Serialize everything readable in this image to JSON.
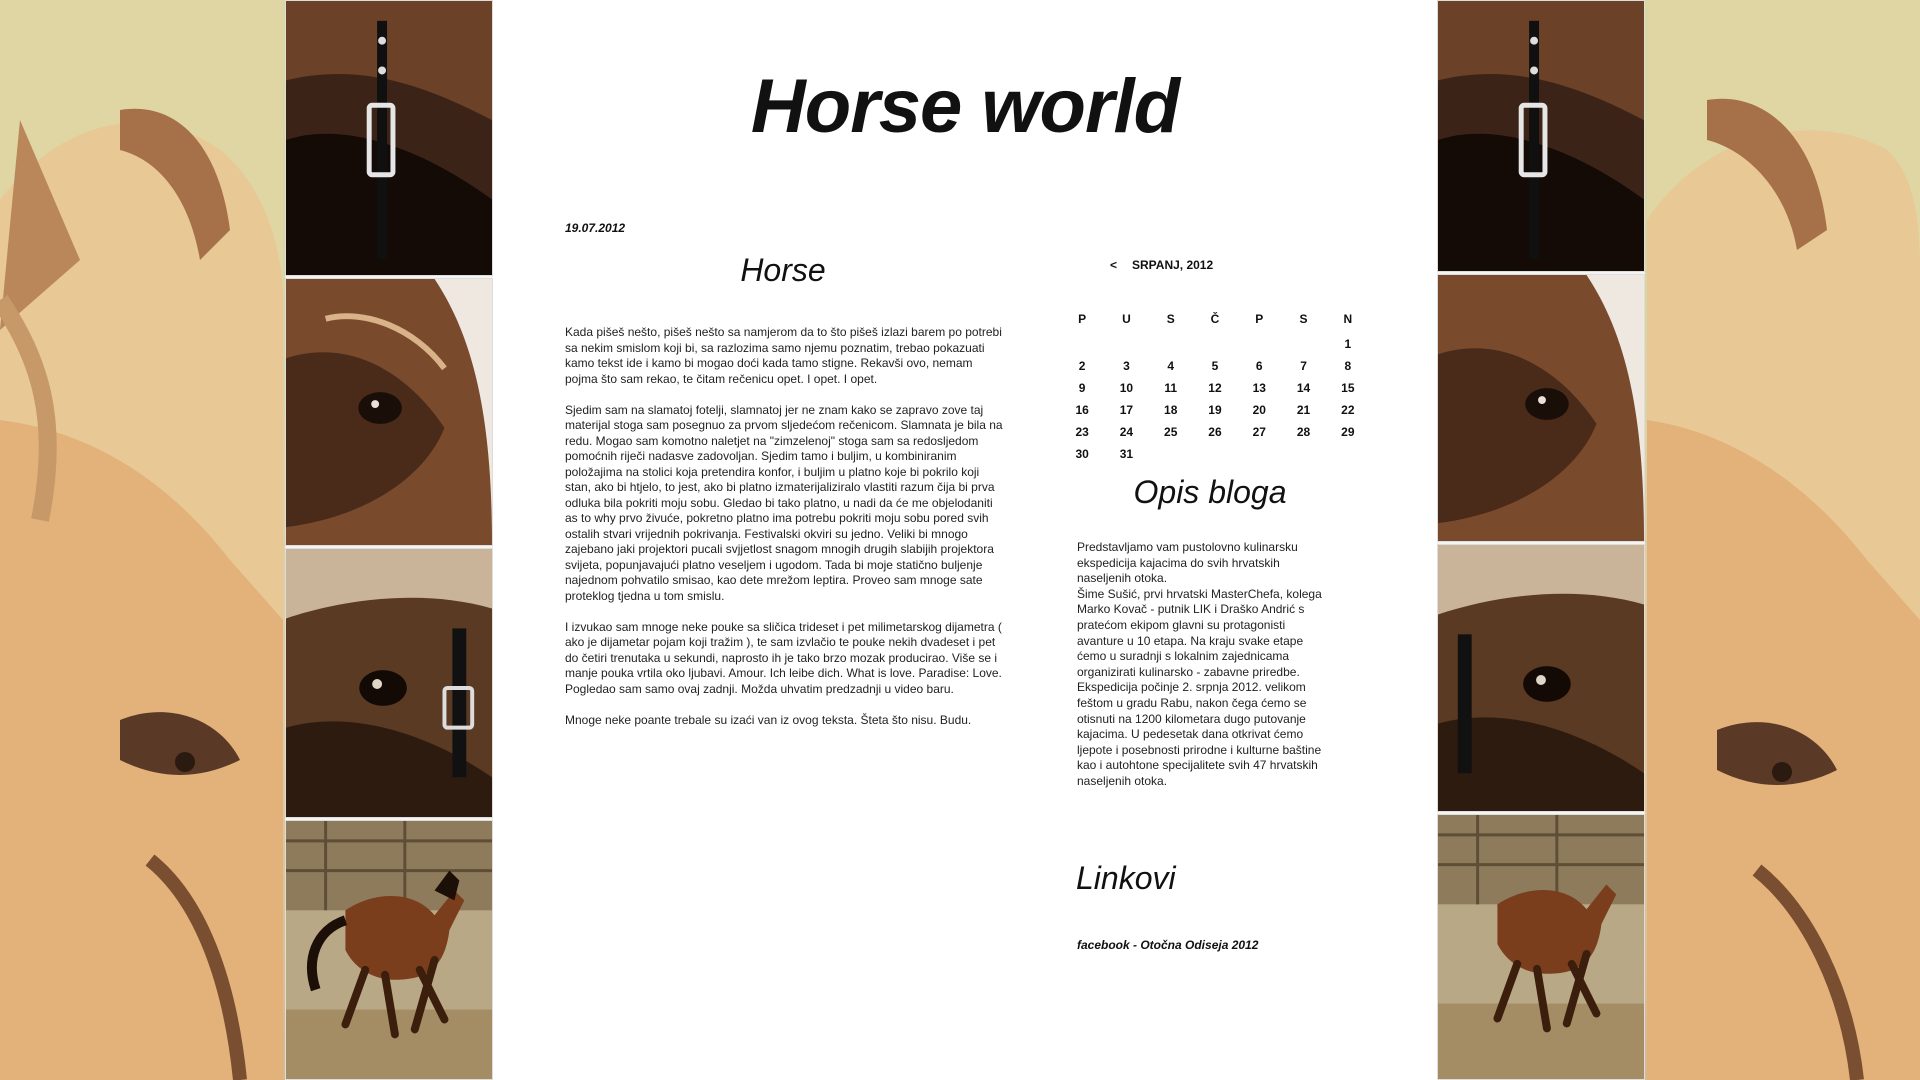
{
  "site": {
    "title": "Horse world"
  },
  "post": {
    "date": "19.07.2012",
    "title": "Horse",
    "paragraphs": [
      "Kada pišeš nešto, pišeš nešto sa namjerom da to što pišeš izlazi barem po potrebi sa nekim smislom koji bi, sa razlozima samo njemu poznatim, trebao pokazuati kamo tekst ide i kamo bi mogao doći kada tamo stigne. Rekavši ovo, nemam pojma što sam rekao, te čitam rečenicu opet. I opet. I opet.",
      "Sjedim sam na slamatoj fotelji, slamnatoj jer ne znam kako se zapravo zove taj materijal stoga sam posegnuo za prvom sljedećom rečenicom. Slamnata je bila na redu. Mogao sam komotno naletjet na \"zimzelenoj\" stoga sam sa redosljedom pomoćnih riječi nadasve zadovoljan. Sjedim tamo i buljim, u kombiniranim položajima na stolici koja pretendira konfor, i buljim u platno koje bi pokrilo koji stan, ako bi htjelo, to jest, ako bi platno izmaterijaliziralo vlastiti razum čija bi prva odluka bila pokriti moju sobu. Gledao bi tako platno, u nadi da će me objelodaniti as to why prvo živuće, pokretno platno ima potrebu pokriti moju sobu pored svih ostalih stvari vrijednih pokrivanja. Festivalski okviri su jedno. Veliki bi mnogo zajebano jaki projektori pucali svjjetlost snagom mnogih drugih slabijih projektora svijeta, popunjavajući platno veseljem i ugodom. Tada bi moje statično buljenje najednom pohvatilo smisao, kao dete mrežom leptira. Proveo sam mnoge sate proteklog tjedna u tom smislu.",
      "I izvukao sam mnoge neke pouke sa sličica trideset i pet milimetarskog dijametra ( ako je dijametar pojam koji tražim ), te sam izvlačio te pouke nekih dvadeset i pet do četiri trenutaka u sekundi, naprosto ih je tako brzo mozak producirao. Više se i manje pouka vrtila oko ljubavi. Amour. Ich leibe dich. What is love. Paradise: Love. Pogledao sam samo ovaj zadnji. Možda uhvatim predzadnji u video baru.",
      "Mnoge neke poante trebale su izaći van iz ovog teksta. Šteta što nisu. Budu."
    ]
  },
  "calendar": {
    "prev_symbol": "<",
    "month_label": "SRPANJ, 2012",
    "weekdays": [
      "P",
      "U",
      "S",
      "Č",
      "P",
      "S",
      "N"
    ],
    "weeks": [
      [
        "",
        "",
        "",
        "",
        "",
        "",
        "1"
      ],
      [
        "2",
        "3",
        "4",
        "5",
        "6",
        "7",
        "8"
      ],
      [
        "9",
        "10",
        "11",
        "12",
        "13",
        "14",
        "15"
      ],
      [
        "16",
        "17",
        "18",
        "19",
        "20",
        "21",
        "22"
      ],
      [
        "23",
        "24",
        "25",
        "26",
        "27",
        "28",
        "29"
      ],
      [
        "30",
        "31",
        "",
        "",
        "",
        "",
        ""
      ]
    ]
  },
  "description": {
    "title": "Opis bloga",
    "lines": [
      "Predstavljamo vam pustolovno kulinarsku",
      "ekspedicija kajacima do svih hrvatskih",
      "naseljenih otoka.",
      "Šime Sušić, prvi hrvatski MasterChefa, kolega",
      "Marko Kovač - putnik LIK i Draško Andrić s",
      "pratećom ekipom glavni su protagonisti",
      "avanture u 10 etapa. Na kraju svake etape",
      "ćemo u suradnji s lokalnim zajednicama",
      "organizirati kulinarsko - zabavne priredbe.",
      "Ekspedicija počinje 2. srpnja 2012. velikom",
      "feštom u gradu Rabu, nakon čega ćemo se",
      "otisnuti na 1200 kilometara dugo putovanje",
      "kajacima. U pedesetak dana otkrivat ćemo",
      "ljepote i posebnosti prirodne i kulturne baštine",
      "kao i autohtone specijalitete svih 47 hrvatskih",
      "naseljenih otoka."
    ]
  },
  "links": {
    "title": "Linkovi",
    "items": [
      "facebook - Otočna Odiseja 2012"
    ]
  },
  "images": {
    "tiles": [
      "horse-bridle-photo",
      "horse-eye-closeup-photo",
      "horse-eye-halter-photo",
      "running-horse-photo"
    ]
  },
  "colors": {
    "page": "#ffffff",
    "text": "#111111",
    "background_tint": "#dcd2a6"
  }
}
